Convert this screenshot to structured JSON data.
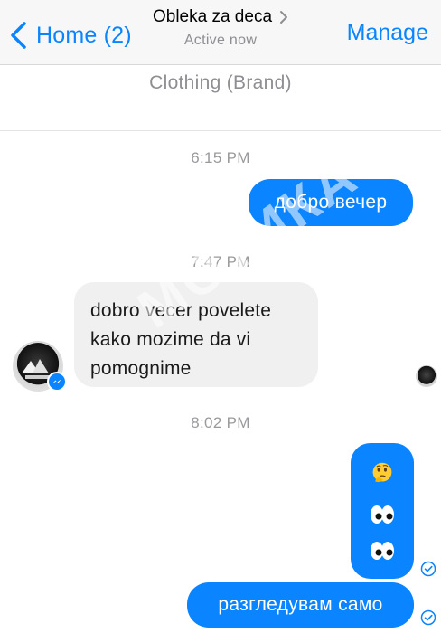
{
  "header": {
    "back_label": "Home (2)",
    "title": "Obleka za deca",
    "subtitle": "Active now",
    "manage_label": "Manage"
  },
  "category": "Clothing (Brand)",
  "watermark": "МОТИКА",
  "messages": [
    {
      "timestamp": "6:15 PM",
      "text": "добро вечер",
      "sender": "me"
    },
    {
      "timestamp": "7:47 PM",
      "lines": [
        "dobro vecer povelete",
        "kako mozime da vi",
        "pomognime"
      ],
      "sender": "page"
    },
    {
      "timestamp": "8:02 PM",
      "emojis": [
        "thinking-face-icon",
        "eyes-icon",
        "eyes-icon"
      ],
      "sender": "me"
    },
    {
      "text": "разгледувам само",
      "sender": "me"
    }
  ],
  "colors": {
    "accent": "#0a84ff",
    "incoming_bubble": "#f0f0f0",
    "timestamp": "#9a9a9e"
  }
}
